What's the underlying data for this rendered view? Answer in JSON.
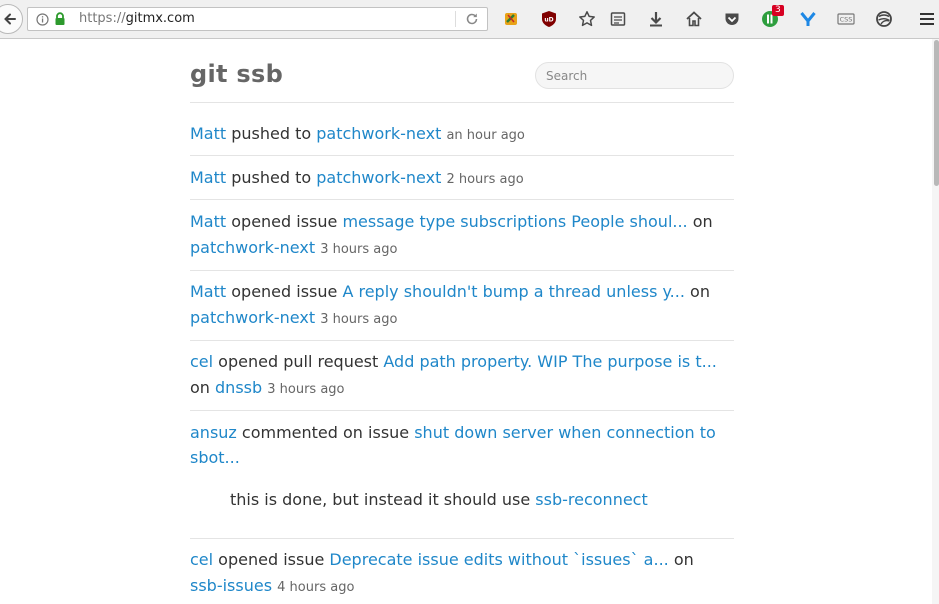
{
  "browser": {
    "url_scheme": "https://",
    "url_host": "gitmx.com",
    "notification_count": "3"
  },
  "header": {
    "title": "git ssb",
    "search_placeholder": "Search"
  },
  "feed": [
    {
      "user": "Matt",
      "action": " pushed to ",
      "target": "patchwork-next",
      "time": "an hour ago"
    },
    {
      "user": "Matt",
      "action": " pushed to ",
      "target": "patchwork-next",
      "time": "2 hours ago"
    },
    {
      "user": "Matt",
      "action": " opened issue ",
      "title": "message type subscriptions People shoul...",
      "on": " on",
      "repo": "patchwork-next",
      "time": "3 hours ago"
    },
    {
      "user": "Matt",
      "action": " opened issue ",
      "title": "A reply shouldn't bump a thread unless y...",
      "on": " on",
      "repo": "patchwork-next",
      "time": "3 hours ago"
    },
    {
      "user": "cel",
      "action": " opened pull request ",
      "title": "Add path property. WIP The purpose is t...",
      "on": "on ",
      "repo": "dnssb",
      "time": "3 hours ago"
    },
    {
      "user": "ansuz",
      "action": " commented on issue ",
      "title": "shut down server when connection to",
      "title_cont": "sbot...",
      "comment_text": "this is done, but instead it should use ",
      "comment_link": "ssb-reconnect"
    },
    {
      "user": "cel",
      "action": " opened issue ",
      "title": "Deprecate issue edits without `issues` a...",
      "on": " on",
      "repo": "ssb-issues",
      "time": "4 hours ago"
    }
  ]
}
